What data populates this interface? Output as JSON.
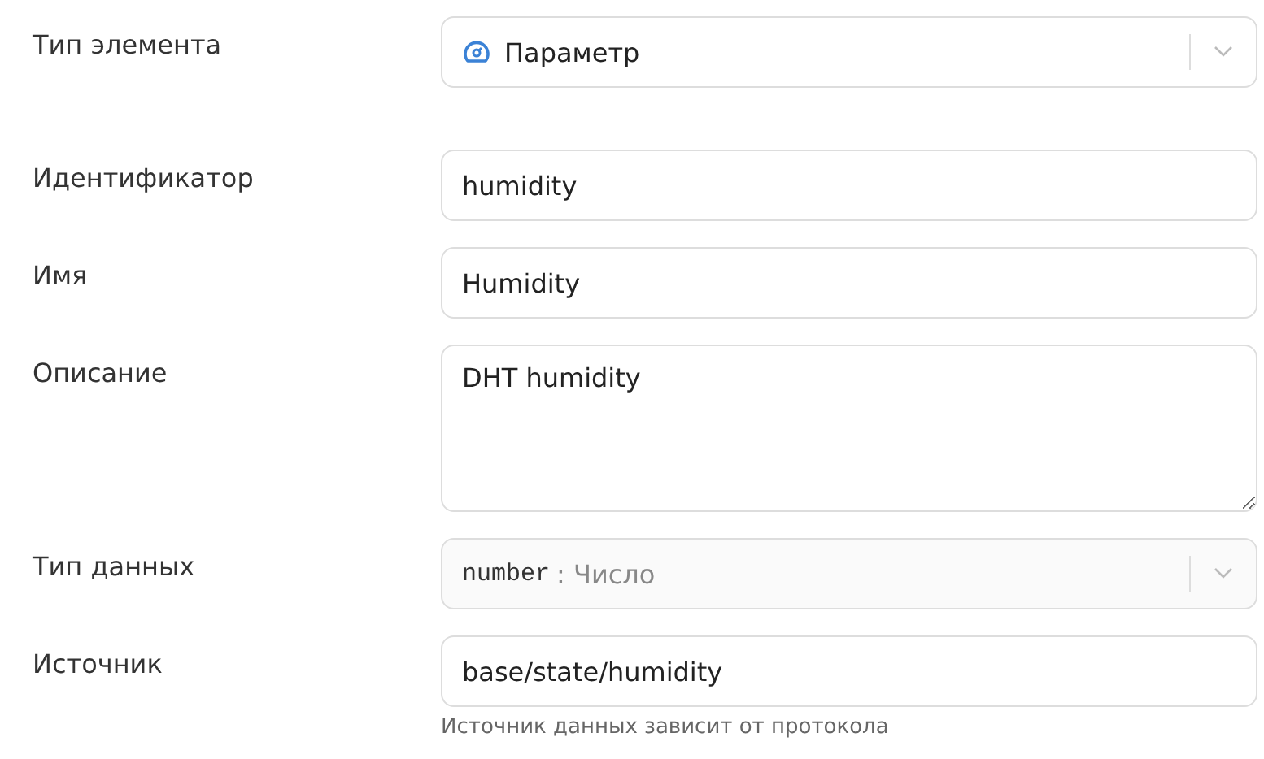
{
  "fields": [
    {
      "kind": "select",
      "label": "Тип элемента",
      "value": "Параметр",
      "icon": true,
      "disabled": false
    },
    {
      "kind": "input",
      "label": "Идентификатор",
      "value": "humidity"
    },
    {
      "kind": "input",
      "label": "Имя",
      "value": "Humidity"
    },
    {
      "kind": "textarea",
      "label": "Описание",
      "value": "DHT humidity"
    },
    {
      "kind": "select",
      "label": "Тип данных",
      "code": "number",
      "value": ": Число",
      "icon": false,
      "disabled": true
    },
    {
      "kind": "input",
      "label": "Источник",
      "value": "base/state/humidity",
      "hint": "Источник данных зависит от протокола"
    }
  ]
}
